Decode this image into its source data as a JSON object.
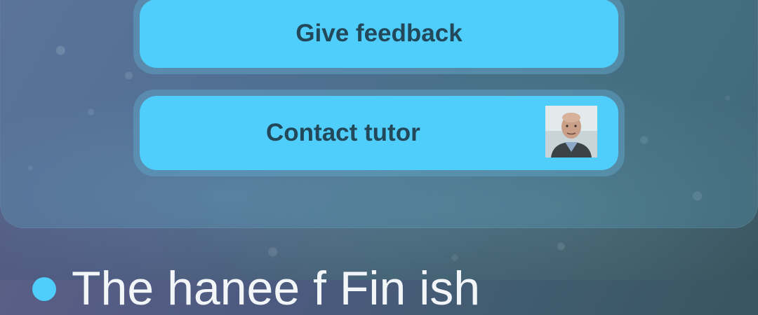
{
  "buttons": {
    "give_feedback_label": "Give feedback",
    "contact_tutor_label": "Contact tutor"
  },
  "section": {
    "title_partial": "The   hanee   f  Fin  ish"
  },
  "colors": {
    "button_fill": "#4fcdfb",
    "button_text": "#23485a",
    "accent_bullet": "#4fcdfb"
  }
}
